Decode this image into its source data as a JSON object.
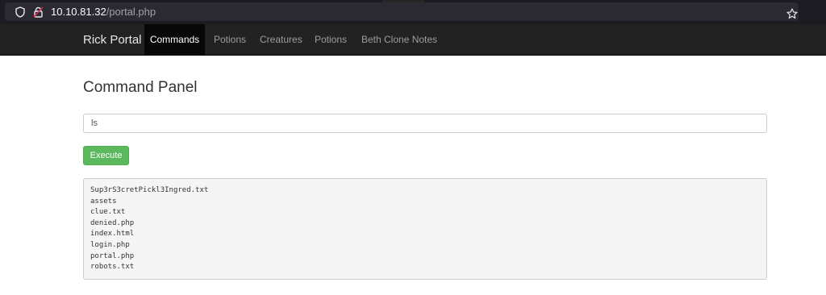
{
  "browser": {
    "url_host": "10.10.81.32",
    "url_path": "/portal.php",
    "icons": [
      "shield-icon",
      "lock-icon",
      "star-icon"
    ]
  },
  "navbar": {
    "brand": "Rick Portal",
    "items": [
      {
        "label": "Commands",
        "active": true
      },
      {
        "label": "Potions"
      },
      {
        "label": "Creatures"
      },
      {
        "label": "Potions"
      },
      {
        "label": "Beth Clone Notes"
      }
    ]
  },
  "main": {
    "title": "Command Panel",
    "command_value": "ls",
    "execute_label": "Execute",
    "output_lines": [
      "Sup3rS3cretPickl3Ingred.txt",
      "assets",
      "clue.txt",
      "denied.php",
      "index.html",
      "login.php",
      "portal.php",
      "robots.txt"
    ]
  },
  "colors": {
    "navbar_bg": "#222222",
    "nav_active_bg": "#080808",
    "button_green": "#5cb85c",
    "output_bg": "#f5f5f5"
  }
}
